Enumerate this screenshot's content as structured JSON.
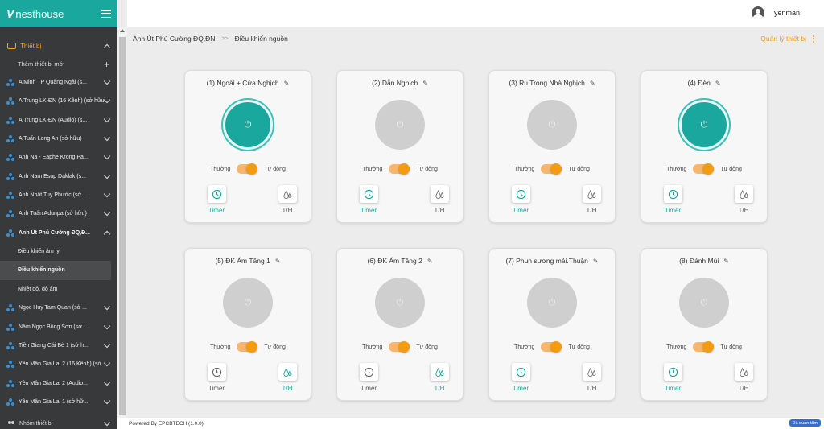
{
  "brand": {
    "name": "nesthouse",
    "mark": "V"
  },
  "user": {
    "name": "yenman"
  },
  "breadcrumb": {
    "parent": "Anh Út Phú Cường ĐQ,ĐN",
    "sep": ">>",
    "current": "Điều khiển nguồn"
  },
  "manage_label": "Quản lý thiết bị",
  "sidebar": {
    "section": "Thiết bị",
    "add_label": "Thêm thiết bị mới",
    "items_before": [
      "A Minh TP Quảng Ngãi (s...",
      "A Trung LK-ĐN (16 Kênh) (sở hữu)",
      "A Trung LK-ĐN (Audio) (s...",
      "A Tuấn Long An (sở hữu)",
      "Anh Na - Eaphe Krong Pa...",
      "Anh Nam Esup Daklak (s...",
      "Anh Nhật Tuy Phước (sở ...",
      "Anh Tuấn Adunpa (sở hữu)"
    ],
    "open_item": "Anh Út Phú Cường ĐQ,Đ...",
    "sub_items": [
      "Điều khiển âm ly",
      "Điều khiển nguồn",
      "Nhiệt độ, độ ẩm"
    ],
    "items_after": [
      "Ngọc Huy Tam Quan (sở ...",
      "Năm Ngọc Bồng Sơn (sở ...",
      "Tiền Giang Cái Bè 1 (sở h...",
      "Yên Mân Gia Lai 2 (16 Kênh) (sở ...",
      "Yên Mân Gia Lai 2 (Audio...",
      "Yên Mân Gia Lai 1 (sở hữ..."
    ],
    "group_label": "Nhóm thiết bị"
  },
  "labels": {
    "manual": "Thường",
    "auto": "Tự động",
    "timer": "Timer",
    "th": "T/H"
  },
  "cards": [
    {
      "title": "(1) Ngoài + Cửa.Nghịch",
      "on": true,
      "active": "timer"
    },
    {
      "title": "(2) Dẫn.Nghịch",
      "on": false,
      "active": "timer"
    },
    {
      "title": "(3) Ru Trong Nhà.Nghịch",
      "on": false,
      "active": "timer"
    },
    {
      "title": "(4) Đèn",
      "on": true,
      "active": "timer"
    },
    {
      "title": "(5) ĐK Ẩm Tầng 1",
      "on": false,
      "active": "th"
    },
    {
      "title": "(6) ĐK Ẩm Tầng 2",
      "on": false,
      "active": "th"
    },
    {
      "title": "(7) Phun sương mái.Thuận",
      "on": false,
      "active": "timer"
    },
    {
      "title": "(8) Đánh Mùi",
      "on": false,
      "active": "timer"
    }
  ],
  "footer": {
    "text": "Powered By EPCBTECH (1.0.0)",
    "chat": "Đã quan tâm"
  },
  "colors": {
    "accent": "#1aa79d",
    "orange": "#f39c12",
    "sidebar": "#37393a"
  }
}
